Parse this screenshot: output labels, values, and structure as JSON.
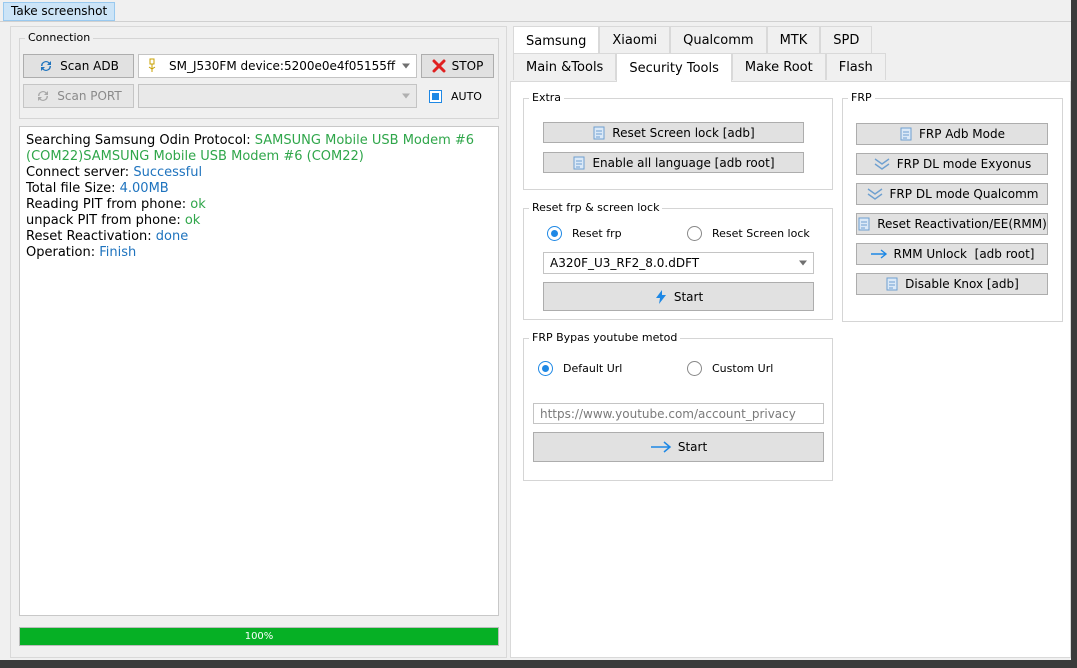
{
  "topbar": {
    "screenshot_label": "Take screenshot"
  },
  "connection": {
    "legend": "Connection",
    "scan_adb_label": "Scan ADB",
    "device_value": "SM_J530FM device:5200e0e4f05155ff",
    "stop_label": "STOP",
    "scan_port_label": "Scan PORT",
    "port_value": "",
    "auto_label": "AUTO"
  },
  "log": {
    "lines": [
      {
        "label": "Searching Samsung Odin Protocol: ",
        "value": "SAMSUNG Mobile USB Modem #6 (COM22)SAMSUNG Mobile USB Modem #6 (COM22)"
      },
      {
        "label": "Connect server: ",
        "value": "Successful"
      },
      {
        "label": "Total file Size: ",
        "value": "4.00MB"
      },
      {
        "label": "Reading PIT from phone: ",
        "value": "ok"
      },
      {
        "label": "unpack PIT from phone: ",
        "value": "ok"
      },
      {
        "label": "Reset Reactivation: ",
        "value": "done"
      },
      {
        "label": "Operation: ",
        "value": "Finish"
      }
    ]
  },
  "progress": {
    "value": 1.0,
    "label": "100%"
  },
  "brand_tabs": [
    "Samsung",
    "Xiaomi",
    "Qualcomm",
    "MTK",
    "SPD"
  ],
  "sub_tabs": [
    "Main &Tools",
    "Security Tools",
    "Make Root",
    "Flash"
  ],
  "extra": {
    "legend": "Extra",
    "reset_screen_lock": "Reset Screen lock [adb]",
    "enable_all_language": "Enable all language [adb root]"
  },
  "reset_frp": {
    "legend": "Reset frp & screen lock",
    "radio_frp": "Reset frp",
    "radio_screen_lock": "Reset Screen lock",
    "firmware_value": "A320F_U3_RF2_8.0.dDFT",
    "start_label": "Start"
  },
  "frp_youtube": {
    "legend": "FRP Bypas youtube metod",
    "radio_default": "Default Url",
    "radio_custom": "Custom Url",
    "url_placeholder": "https://www.youtube.com/account_privacy",
    "start_label": "Start"
  },
  "frp": {
    "legend": "FRP",
    "adb_mode": "FRP Adb Mode",
    "dl_exynos": "FRP DL mode Exyonus",
    "dl_qualcomm": "FRP DL mode Qualcomm",
    "reset_reactivation": "Reset Reactivation/EE(RMM)",
    "rmm_unlock": "RMM Unlock  [adb root]",
    "disable_knox": "Disable Knox [adb]"
  },
  "colors": {
    "accent": "#1e88e5",
    "success": "#2fa64a",
    "info": "#1e73be",
    "progress": "#06b025",
    "stop": "#e02020"
  }
}
